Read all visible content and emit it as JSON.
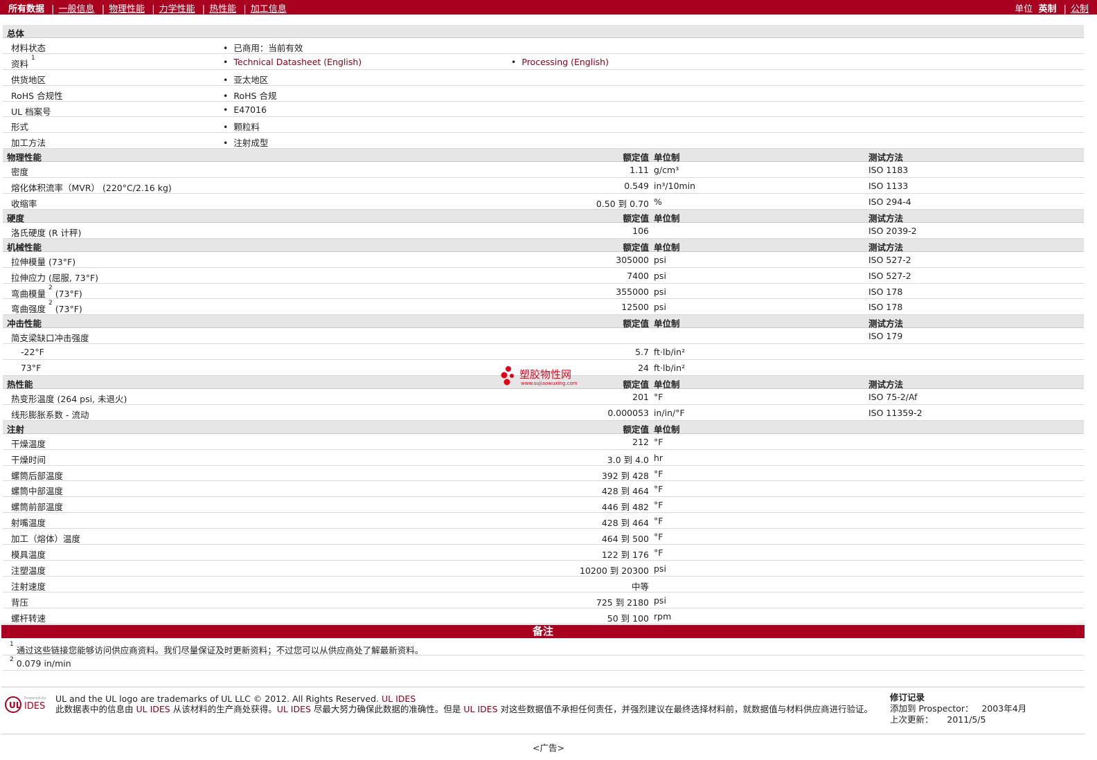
{
  "nav": {
    "all_data": "所有数据",
    "tabs": [
      "一般信息",
      "物理性能",
      "力学性能",
      "热性能",
      "加工信息"
    ],
    "unit_label": "单位",
    "unit_imperial": "英制",
    "unit_metric": "公制"
  },
  "col_headers": {
    "nominal": "额定值",
    "unit": "单位制",
    "test_method": "测试方法"
  },
  "general": {
    "title": "总体",
    "rows": [
      {
        "label": "材料状态",
        "values": [
          "已商用：当前有效"
        ]
      },
      {
        "label": "资料",
        "sup": "1",
        "links": [
          "Technical Datasheet (English)",
          "Processing (English)"
        ]
      },
      {
        "label": "供货地区",
        "values": [
          "亚太地区"
        ]
      },
      {
        "label": "RoHS 合规性",
        "values": [
          "RoHS 合规"
        ]
      },
      {
        "label": "UL 档案号",
        "values": [
          "E47016"
        ]
      },
      {
        "label": "形式",
        "values": [
          "颗粒料"
        ]
      },
      {
        "label": "加工方法",
        "values": [
          "注射成型"
        ]
      }
    ]
  },
  "sections": [
    {
      "title": "物理性能",
      "show_test": true,
      "rows": [
        {
          "label": "密度",
          "value": "1.11",
          "unit": "g/cm³",
          "test": "ISO 1183"
        },
        {
          "label": "熔化体积流率（MVR） (220°C/2.16 kg)",
          "value": "0.549",
          "unit": "in³/10min",
          "test": "ISO 1133"
        },
        {
          "label": "收缩率",
          "value": "0.50 到  0.70",
          "unit": "%",
          "test": "ISO 294-4"
        }
      ]
    },
    {
      "title": "硬度",
      "show_test": true,
      "rows": [
        {
          "label": "洛氏硬度 (R 计秤)",
          "value": "106",
          "unit": "",
          "test": "ISO 2039-2"
        }
      ]
    },
    {
      "title": "机械性能",
      "show_test": true,
      "rows": [
        {
          "label": "拉伸模量 (73°F)",
          "value": "305000",
          "unit": "psi",
          "test": "ISO 527-2"
        },
        {
          "label": "拉伸应力 (屈服, 73°F)",
          "value": "7400",
          "unit": "psi",
          "test": "ISO 527-2"
        },
        {
          "label": "弯曲模量",
          "sup": "2",
          "label_suffix": " (73°F)",
          "value": "355000",
          "unit": "psi",
          "test": "ISO 178"
        },
        {
          "label": "弯曲强度",
          "sup": "2",
          "label_suffix": " (73°F)",
          "value": "12500",
          "unit": "psi",
          "test": "ISO 178"
        }
      ]
    },
    {
      "title": "冲击性能",
      "show_test": true,
      "rows": [
        {
          "label": "简支梁缺口冲击强度",
          "value": "",
          "unit": "",
          "test": "ISO 179"
        },
        {
          "label": "-22°F",
          "indent": true,
          "value": "5.7",
          "unit": "ft·lb/in²",
          "test": ""
        },
        {
          "label": "73°F",
          "indent": true,
          "value": "24",
          "unit": "ft·lb/in²",
          "test": ""
        }
      ]
    },
    {
      "title": "热性能",
      "show_test": true,
      "rows": [
        {
          "label": "热变形温度 (264 psi, 未退火)",
          "value": "201",
          "unit": "°F",
          "test": "ISO 75-2/Af"
        },
        {
          "label": "线形膨胀系数  - 流动",
          "value": "0.000053",
          "unit": "in/in/°F",
          "test": "ISO 11359-2"
        }
      ]
    },
    {
      "title": "注射",
      "show_test": false,
      "rows": [
        {
          "label": "干燥温度",
          "value": "212",
          "unit": "°F",
          "test": ""
        },
        {
          "label": "干燥时间",
          "value": "3.0 到  4.0",
          "unit": "hr",
          "test": ""
        },
        {
          "label": "螺筒后部温度",
          "value": "392 到  428",
          "unit": "°F",
          "test": ""
        },
        {
          "label": "螺筒中部温度",
          "value": "428 到  464",
          "unit": "°F",
          "test": ""
        },
        {
          "label": "螺筒前部温度",
          "value": "446 到  482",
          "unit": "°F",
          "test": ""
        },
        {
          "label": "射嘴温度",
          "value": "428 到  464",
          "unit": "°F",
          "test": ""
        },
        {
          "label": "加工（熔体）温度",
          "value": "464 到  500",
          "unit": "°F",
          "test": ""
        },
        {
          "label": "模具温度",
          "value": "122 到  176",
          "unit": "°F",
          "test": ""
        },
        {
          "label": "注塑温度",
          "value": "10200 到  20300",
          "unit": "psi",
          "test": ""
        },
        {
          "label": "注射速度",
          "value": "中等",
          "unit": "",
          "test": ""
        },
        {
          "label": "背压",
          "value": "725 到  2180",
          "unit": "psi",
          "test": ""
        },
        {
          "label": "螺杆转速",
          "value": "50 到  100",
          "unit": "rpm",
          "test": ""
        }
      ]
    }
  ],
  "notes": {
    "title": "备注",
    "items": [
      {
        "sup": "1",
        "text": "通过这些链接您能够访问供应商资料。我们尽量保证及时更新资料；不过您可以从供应商处了解最新资料。"
      },
      {
        "sup": "2",
        "text": "0.079 in/min"
      }
    ]
  },
  "watermark": {
    "text": "塑胶物性网",
    "url": "www.sujiaowuxing.com"
  },
  "footer": {
    "logo_powered": "Powered by",
    "logo_text": "IDES",
    "trademark": "UL and the UL logo are trademarks of UL LLC © 2012. All Rights Reserved.",
    "ul_ides": "UL IDES",
    "disclaimer_a": "此数据表中的信息由 ",
    "disclaimer_b": " 从该材料的生产商处获得。",
    "disclaimer_c": " 尽最大努力确保此数据的准确性。但是 ",
    "disclaimer_d": " 对这些数据值不承担任何责任，并强烈建议在最终选择材料前，就数据值与材料供应商进行验证。",
    "rev_title": "修订记录",
    "added_label": "添加到  Prospector：",
    "added_value": "2003年4月",
    "updated_label": "上次更新：",
    "updated_value": "2011/5/5",
    "ad": "<广告>",
    "colors": {
      "brand": "#a8001e",
      "section_bg": "#e6e6e6"
    }
  }
}
